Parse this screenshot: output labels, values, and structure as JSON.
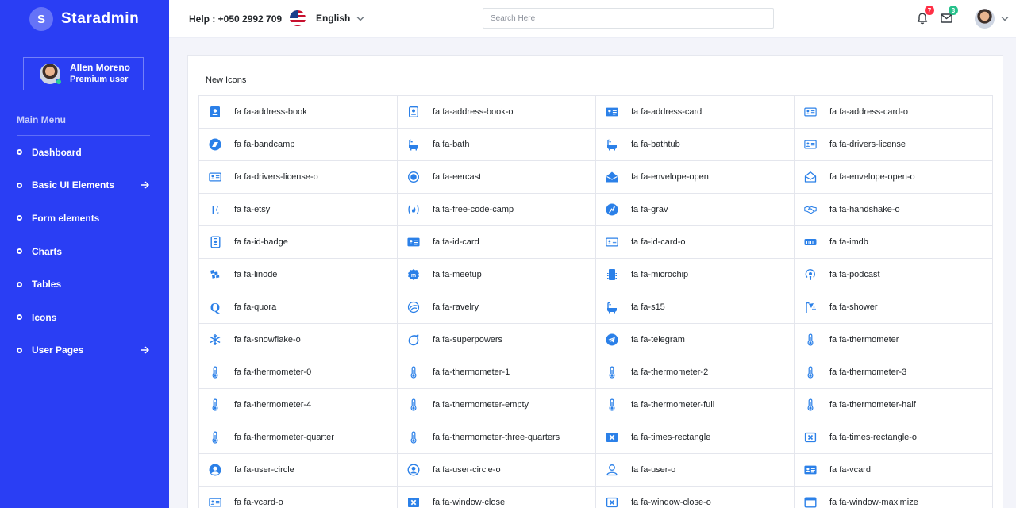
{
  "brand": {
    "logo_letter": "S",
    "name": "Staradmin"
  },
  "profile": {
    "name": "Allen Moreno",
    "role": "Premium user"
  },
  "sidebar": {
    "menu_title": "Main Menu",
    "items": [
      {
        "label": "Dashboard",
        "has_arrow": false
      },
      {
        "label": "Basic UI Elements",
        "has_arrow": true
      },
      {
        "label": "Form elements",
        "has_arrow": false
      },
      {
        "label": "Charts",
        "has_arrow": false
      },
      {
        "label": "Tables",
        "has_arrow": false
      },
      {
        "label": "Icons",
        "has_arrow": false
      },
      {
        "label": "User Pages",
        "has_arrow": true
      }
    ]
  },
  "header": {
    "help_text": "Help : +050 2992 709",
    "language": "English",
    "search_placeholder": "Search Here",
    "notifications_count": "7",
    "messages_count": "3"
  },
  "card": {
    "title": "New Icons",
    "icons": [
      {
        "label": "fa fa-address-book",
        "icon": "address-book"
      },
      {
        "label": "fa fa-address-book-o",
        "icon": "address-book-o"
      },
      {
        "label": "fa fa-address-card",
        "icon": "address-card"
      },
      {
        "label": "fa fa-address-card-o",
        "icon": "address-card-o"
      },
      {
        "label": "fa fa-bandcamp",
        "icon": "bandcamp"
      },
      {
        "label": "fa fa-bath",
        "icon": "bath"
      },
      {
        "label": "fa fa-bathtub",
        "icon": "bath"
      },
      {
        "label": "fa fa-drivers-license",
        "icon": "address-card-o"
      },
      {
        "label": "fa fa-drivers-license-o",
        "icon": "address-card-o"
      },
      {
        "label": "fa fa-eercast",
        "icon": "eercast"
      },
      {
        "label": "fa fa-envelope-open",
        "icon": "envelope-open"
      },
      {
        "label": "fa fa-envelope-open-o",
        "icon": "envelope-open-o"
      },
      {
        "label": "fa fa-etsy",
        "icon": "etsy"
      },
      {
        "label": "fa fa-free-code-camp",
        "icon": "free-code-camp"
      },
      {
        "label": "fa fa-grav",
        "icon": "grav"
      },
      {
        "label": "fa fa-handshake-o",
        "icon": "handshake"
      },
      {
        "label": "fa fa-id-badge",
        "icon": "id-badge"
      },
      {
        "label": "fa fa-id-card",
        "icon": "address-card"
      },
      {
        "label": "fa fa-id-card-o",
        "icon": "address-card-o"
      },
      {
        "label": "fa fa-imdb",
        "icon": "imdb"
      },
      {
        "label": "fa fa-linode",
        "icon": "linode"
      },
      {
        "label": "fa fa-meetup",
        "icon": "meetup"
      },
      {
        "label": "fa fa-microchip",
        "icon": "microchip"
      },
      {
        "label": "fa fa-podcast",
        "icon": "podcast"
      },
      {
        "label": "fa fa-quora",
        "icon": "quora"
      },
      {
        "label": "fa fa-ravelry",
        "icon": "ravelry"
      },
      {
        "label": "fa fa-s15",
        "icon": "bath"
      },
      {
        "label": "fa fa-shower",
        "icon": "shower"
      },
      {
        "label": "fa fa-snowflake-o",
        "icon": "snowflake"
      },
      {
        "label": "fa fa-superpowers",
        "icon": "superpowers"
      },
      {
        "label": "fa fa-telegram",
        "icon": "telegram"
      },
      {
        "label": "fa fa-thermometer",
        "icon": "thermometer"
      },
      {
        "label": "fa fa-thermometer-0",
        "icon": "thermometer"
      },
      {
        "label": "fa fa-thermometer-1",
        "icon": "thermometer"
      },
      {
        "label": "fa fa-thermometer-2",
        "icon": "thermometer"
      },
      {
        "label": "fa fa-thermometer-3",
        "icon": "thermometer"
      },
      {
        "label": "fa fa-thermometer-4",
        "icon": "thermometer"
      },
      {
        "label": "fa fa-thermometer-empty",
        "icon": "thermometer"
      },
      {
        "label": "fa fa-thermometer-full",
        "icon": "thermometer"
      },
      {
        "label": "fa fa-thermometer-half",
        "icon": "thermometer"
      },
      {
        "label": "fa fa-thermometer-quarter",
        "icon": "thermometer"
      },
      {
        "label": "fa fa-thermometer-three-quarters",
        "icon": "thermometer"
      },
      {
        "label": "fa fa-times-rectangle",
        "icon": "times-rectangle"
      },
      {
        "label": "fa fa-times-rectangle-o",
        "icon": "times-rectangle-o"
      },
      {
        "label": "fa fa-user-circle",
        "icon": "user-circle"
      },
      {
        "label": "fa fa-user-circle-o",
        "icon": "user-circle-o"
      },
      {
        "label": "fa fa-user-o",
        "icon": "user-o"
      },
      {
        "label": "fa fa-vcard",
        "icon": "address-card"
      },
      {
        "label": "fa fa-vcard-o",
        "icon": "address-card-o"
      },
      {
        "label": "fa fa-window-close",
        "icon": "times-rectangle"
      },
      {
        "label": "fa fa-window-close-o",
        "icon": "times-rectangle-o"
      },
      {
        "label": "fa fa-window-maximize",
        "icon": "window-maximize"
      }
    ]
  },
  "colors": {
    "sidebar_bg": "#2a3ef4",
    "icon_blue": "#2b80e8",
    "badge_red": "#ff2f45",
    "badge_green": "#26c18b",
    "page_bg": "#f3f4fa"
  }
}
